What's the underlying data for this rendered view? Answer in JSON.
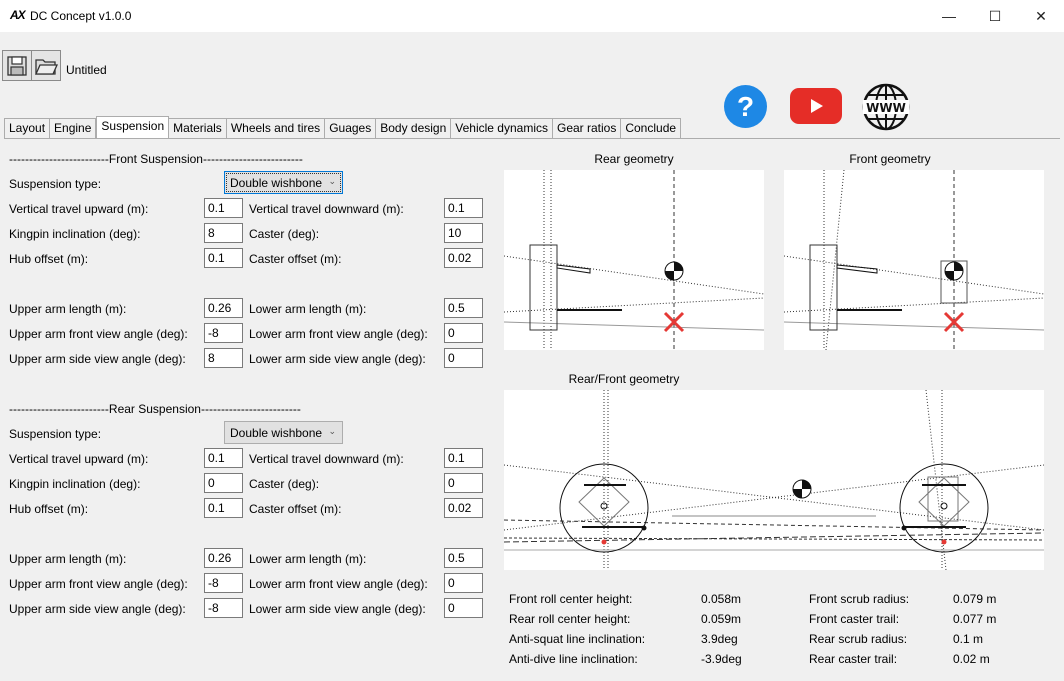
{
  "window": {
    "logo": "AX",
    "title": "DC Concept v1.0.0",
    "minimize": "—",
    "maximize": "☐",
    "close": "✕"
  },
  "file": {
    "name": "Untitled"
  },
  "tabs": [
    "Layout",
    "Engine",
    "Suspension",
    "Materials",
    "Wheels and tires",
    "Guages",
    "Body design",
    "Vehicle dynamics",
    "Gear ratios",
    "Conclude"
  ],
  "front": {
    "header": "-------------------------Front Suspension-------------------------",
    "type_label": "Suspension type:",
    "type_value": "Double wishbone",
    "vt_up_label": "Vertical travel upward (m):",
    "vt_up": "0.1",
    "vt_down_label": "Vertical travel downward (m):",
    "vt_down": "0.1",
    "kpi_label": "Kingpin inclination (deg):",
    "kpi": "8",
    "caster_label": "Caster (deg):",
    "caster": "10",
    "hub_label": "Hub offset (m):",
    "hub": "0.1",
    "caster_off_label": "Caster offset (m):",
    "caster_off": "0.02",
    "ua_len_label": "Upper arm length (m):",
    "ua_len": "0.26",
    "la_len_label": "Lower arm length (m):",
    "la_len": "0.5",
    "ua_fva_label": "Upper arm front view angle (deg):",
    "ua_fva": "-8",
    "la_fva_label": "Lower arm front view angle (deg):",
    "la_fva": "0",
    "ua_sva_label": "Upper arm side view angle (deg):",
    "ua_sva": "8",
    "la_sva_label": "Lower arm side view angle (deg):",
    "la_sva": "0"
  },
  "rear": {
    "header": "-------------------------Rear Suspension-------------------------",
    "type_label": "Suspension type:",
    "type_value": "Double wishbone",
    "vt_up_label": "Vertical travel upward (m):",
    "vt_up": "0.1",
    "vt_down_label": "Vertical travel downward (m):",
    "vt_down": "0.1",
    "kpi_label": "Kingpin inclination (deg):",
    "kpi": "0",
    "caster_label": "Caster (deg):",
    "caster": "0",
    "hub_label": "Hub offset (m):",
    "hub": "0.1",
    "caster_off_label": "Caster offset (m):",
    "caster_off": "0.02",
    "ua_len_label": "Upper arm length (m):",
    "ua_len": "0.26",
    "la_len_label": "Lower arm length (m):",
    "la_len": "0.5",
    "ua_fva_label": "Upper arm front view angle (deg):",
    "ua_fva": "-8",
    "la_fva_label": "Lower arm front view angle (deg):",
    "la_fva": "0",
    "ua_sva_label": "Upper arm side view angle (deg):",
    "ua_sva": "-8",
    "la_sva_label": "Lower arm side view angle (deg):",
    "la_sva": "0"
  },
  "geometry": {
    "rear_title": "Rear geometry",
    "front_title": "Front geometry",
    "both_title": "Rear/Front geometry"
  },
  "results": {
    "front_rc_label": "Front roll center height:",
    "front_rc": "0.058m",
    "rear_rc_label": "Rear roll center height:",
    "rear_rc": "0.059m",
    "anti_squat_label": "Anti-squat line inclination:",
    "anti_squat": "3.9deg",
    "anti_dive_label": "Anti-dive line inclination:",
    "anti_dive": "-3.9deg",
    "front_scrub_label": "Front scrub radius:",
    "front_scrub": "0.079 m",
    "front_trail_label": "Front caster trail:",
    "front_trail": "0.077 m",
    "rear_scrub_label": "Rear scrub radius:",
    "rear_scrub": "0.1 m",
    "rear_trail_label": "Rear caster trail:",
    "rear_trail": "0.02 m"
  },
  "colors": {
    "accent_blue": "#1e88e5",
    "youtube_red": "#e52d27",
    "marker_red": "#e53935"
  }
}
